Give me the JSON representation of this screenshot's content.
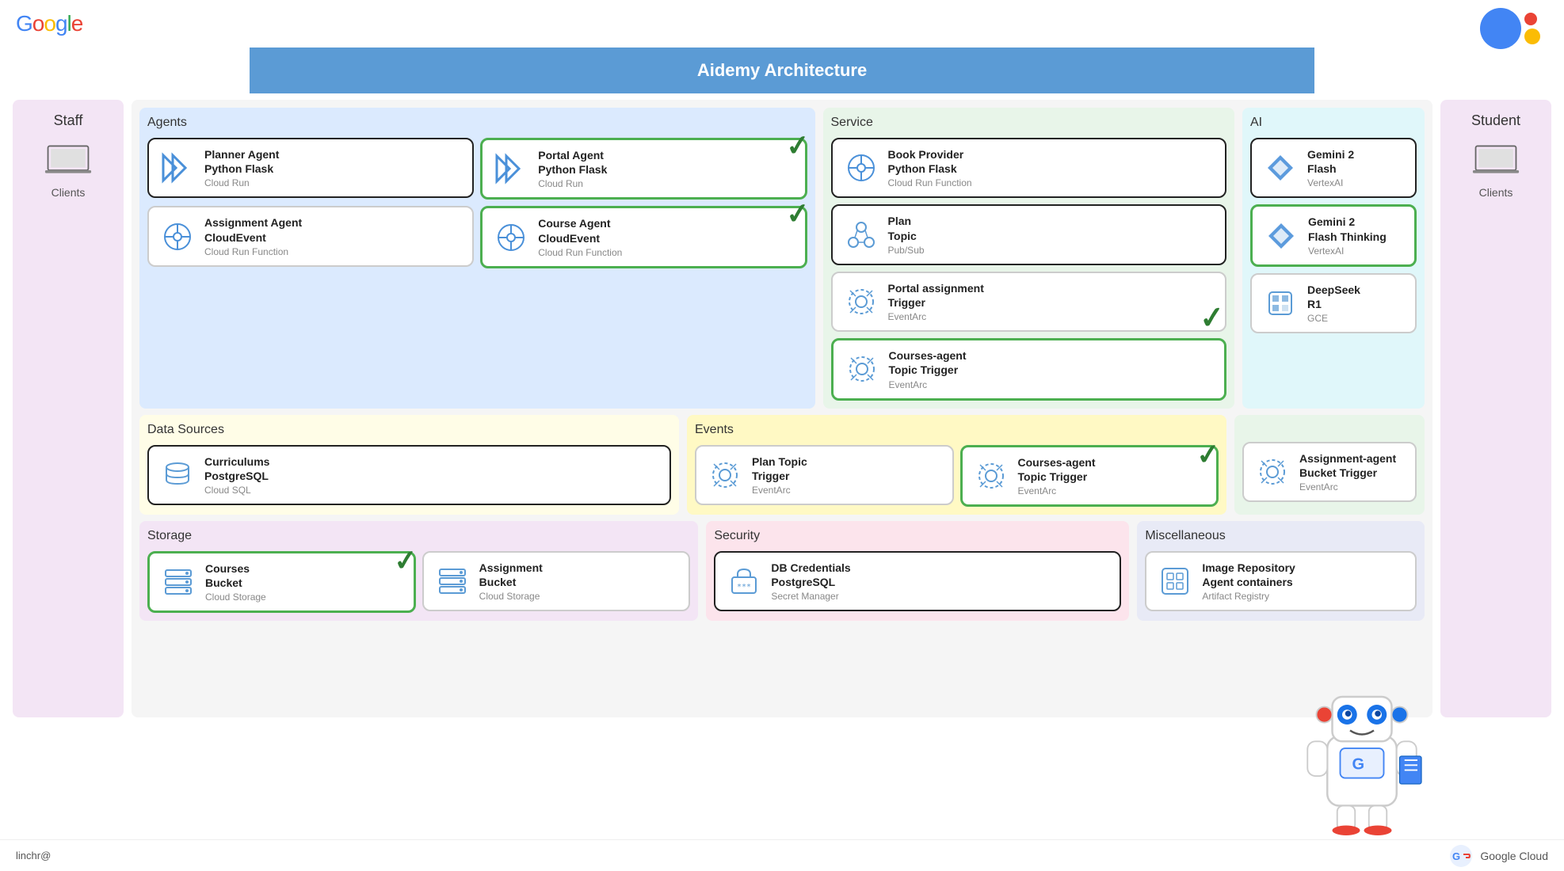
{
  "header": {
    "google_logo": "Google",
    "title": "Aidemy Architecture"
  },
  "footer": {
    "email": "linchr@",
    "cloud_logo": "Google Cloud"
  },
  "sidebar_staff": {
    "title": "Staff",
    "label": "Clients"
  },
  "sidebar_student": {
    "title": "Student",
    "label": "Clients"
  },
  "agents": {
    "section_title": "Agents",
    "cards": [
      {
        "title": "Planner Agent\nPython Flask",
        "sub": "Cloud Run",
        "border": "black",
        "icon": "chevron"
      },
      {
        "title": "Portal Agent\nPython Flask",
        "sub": "Cloud Run",
        "border": "green",
        "icon": "chevron",
        "checked": true
      },
      {
        "title": "Assignment Agent\nCloudEvent",
        "sub": "Cloud Run Function",
        "border": "plain",
        "icon": "api"
      },
      {
        "title": "Course Agent\nCloudEvent",
        "sub": "Cloud Run Function",
        "border": "green",
        "icon": "api",
        "checked": true
      }
    ]
  },
  "service": {
    "section_title": "Service",
    "cards": [
      {
        "title": "Book Provider\nPython Flask",
        "sub": "Cloud Run Function",
        "border": "black",
        "icon": "api"
      },
      {
        "title": "Plan\nTopic",
        "sub": "Pub/Sub",
        "border": "black",
        "icon": "pubsub"
      },
      {
        "title": "Portal assignment\nTrigger",
        "sub": "EventArc",
        "border": "plain",
        "icon": "eventarc",
        "checked": true
      },
      {
        "title": "Courses-agent\nTopic Trigger",
        "sub": "EventArc",
        "border": "green",
        "icon": "eventarc",
        "checked": true
      }
    ]
  },
  "ai": {
    "section_title": "AI",
    "cards": [
      {
        "title": "Gemini 2\nFlash",
        "sub": "VertexAI",
        "border": "black",
        "icon": "gemini"
      },
      {
        "title": "Gemini 2\nFlash Thinking",
        "sub": "VertexAI",
        "border": "green",
        "icon": "gemini"
      },
      {
        "title": "DeepSeek\nR1",
        "sub": "GCE",
        "border": "plain",
        "icon": "deepseek"
      }
    ]
  },
  "datasources": {
    "section_title": "Data Sources",
    "cards": [
      {
        "title": "Curriculums\nPostgreSQL",
        "sub": "Cloud SQL",
        "border": "black",
        "icon": "sql"
      }
    ]
  },
  "events": {
    "section_title": "Events",
    "cards": [
      {
        "title": "Plan Topic\nTrigger",
        "sub": "EventArc",
        "border": "plain",
        "icon": "eventarc"
      },
      {
        "title": "Courses-agent\nTopic Trigger",
        "sub": "EventArc",
        "border": "green",
        "icon": "eventarc"
      }
    ]
  },
  "assign_trigger": {
    "cards": [
      {
        "title": "Assignment-agent\nBucket Trigger",
        "sub": "EventArc",
        "border": "plain",
        "icon": "eventarc"
      }
    ]
  },
  "storage": {
    "section_title": "Storage",
    "cards": [
      {
        "title": "Courses\nBucket",
        "sub": "Cloud Storage",
        "border": "green",
        "icon": "storage",
        "checked": true
      },
      {
        "title": "Assignment\nBucket",
        "sub": "Cloud Storage",
        "border": "plain",
        "icon": "storage"
      }
    ]
  },
  "security": {
    "section_title": "Security",
    "cards": [
      {
        "title": "DB Credentials\nPostgreSQL",
        "sub": "Secret Manager",
        "border": "black",
        "icon": "secret"
      }
    ]
  },
  "misc": {
    "section_title": "Miscellaneous",
    "cards": [
      {
        "title": "Image Repository\nAgent containers",
        "sub": "Artifact Registry",
        "border": "plain",
        "icon": "artifact"
      }
    ]
  }
}
